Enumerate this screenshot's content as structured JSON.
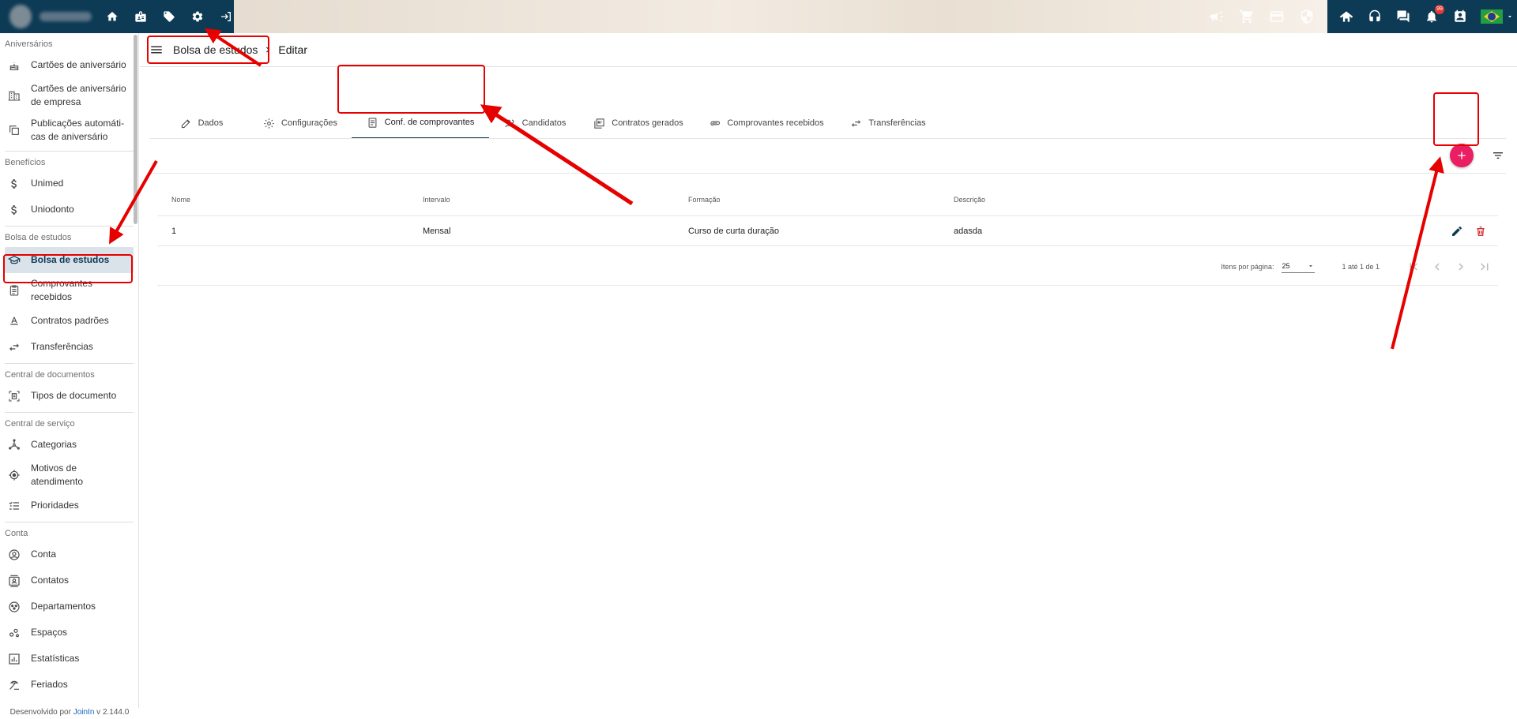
{
  "topbar": {
    "icons_left": [
      "home-icon",
      "badge-icon",
      "tag-icon",
      "gear-icon",
      "logout-icon"
    ],
    "icons_banner": [
      "megaphone-icon",
      "cart-icon",
      "card-icon",
      "shield-icon"
    ],
    "icons_right": [
      "handshake-icon",
      "headset-icon",
      "chat-icon",
      "bell-icon",
      "calendar-icon"
    ],
    "notification_count": "99",
    "language_flag": "brazil-flag"
  },
  "sidebar": {
    "sections": [
      {
        "title": "Aniversários",
        "items": [
          {
            "label": "Cartões de aniversário",
            "icon": "cake-icon"
          },
          {
            "label": "Cartões de aniversário de empresa",
            "icon": "building-icon"
          },
          {
            "label": "Publicações automáti-cas de aniversário",
            "icon": "copy-icon"
          }
        ]
      },
      {
        "title": "Benefícios",
        "items": [
          {
            "label": "Unimed",
            "icon": "dollar-icon"
          },
          {
            "label": "Uniodonto",
            "icon": "dollar-icon"
          }
        ]
      },
      {
        "title": "Bolsa de estudos",
        "items": [
          {
            "label": "Bolsa de estudos",
            "icon": "school-icon",
            "active": true
          },
          {
            "label": "Comprovantes recebidos",
            "icon": "clipboard-icon"
          },
          {
            "label": "Contratos padrões",
            "icon": "text-format-icon"
          },
          {
            "label": "Transferências",
            "icon": "swap-icon"
          }
        ]
      },
      {
        "title": "Central de documentos",
        "items": [
          {
            "label": "Tipos de documento",
            "icon": "document-scan-icon"
          }
        ]
      },
      {
        "title": "Central de serviço",
        "items": [
          {
            "label": "Categorias",
            "icon": "hub-icon"
          },
          {
            "label": "Motivos de atendimento",
            "icon": "target-icon"
          },
          {
            "label": "Prioridades",
            "icon": "priority-icon"
          }
        ]
      },
      {
        "title": "Conta",
        "items": [
          {
            "label": "Conta",
            "icon": "account-circle-icon"
          },
          {
            "label": "Contatos",
            "icon": "contacts-icon"
          },
          {
            "label": "Departamentos",
            "icon": "groups-icon"
          },
          {
            "label": "Espaços",
            "icon": "spaces-icon"
          },
          {
            "label": "Estatísticas",
            "icon": "chart-icon"
          },
          {
            "label": "Feriados",
            "icon": "beach-icon"
          }
        ]
      }
    ],
    "footer": {
      "prefix": "Desenvolvido por ",
      "brand": "JoinIn",
      "version": " v 2.144.0"
    }
  },
  "breadcrumb": {
    "parent": "Bolsa de estudos",
    "current": "Editar"
  },
  "tabs": [
    {
      "label": "Dados",
      "icon": "pencil-icon"
    },
    {
      "label": "Configurações",
      "icon": "gear-icon"
    },
    {
      "label": "Conf. de comprovantes",
      "icon": "receipt-icon",
      "active": true
    },
    {
      "label": "Candidatos",
      "icon": "people-icon"
    },
    {
      "label": "Contratos gerados",
      "icon": "pdf-icon"
    },
    {
      "label": "Comprovantes recebidos",
      "icon": "attachment-icon"
    },
    {
      "label": "Transferências",
      "icon": "swap-icon"
    }
  ],
  "table": {
    "headers": [
      "Nome",
      "Intervalo",
      "Formação",
      "Descrição"
    ],
    "rows": [
      {
        "nome": "1",
        "intervalo": "Mensal",
        "formacao": "Curso de curta duração",
        "descricao": "adasda"
      }
    ]
  },
  "paginator": {
    "items_per_page_label": "Itens por página:",
    "items_per_page": "25",
    "range": "1 até 1 de 1"
  },
  "colors": {
    "primary": "#0d3a55",
    "accent": "#e91e63",
    "annotation": "#e60000",
    "delete": "#d32f2f"
  }
}
